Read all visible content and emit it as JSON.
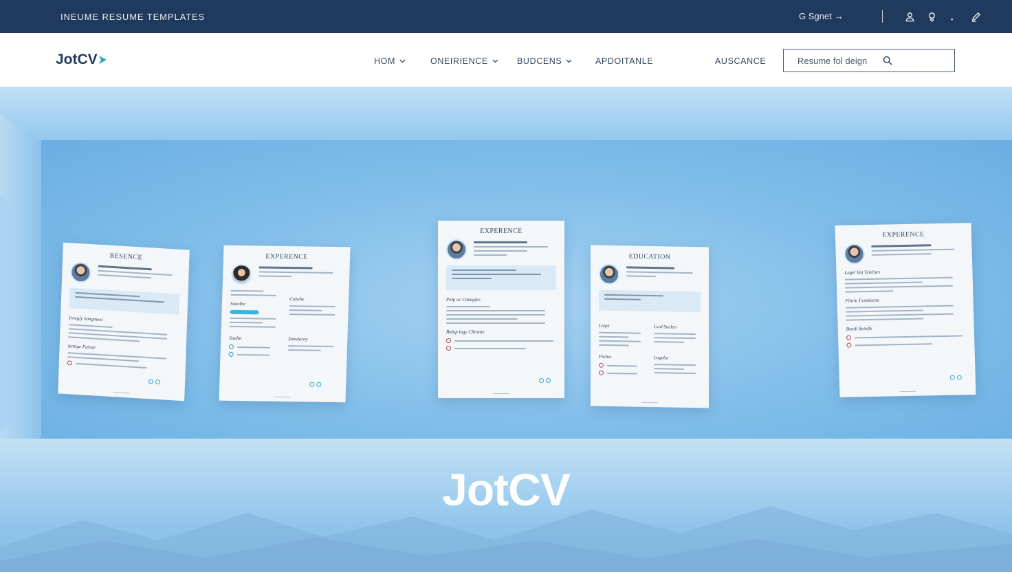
{
  "topbar": {
    "title": "INEUME RESUME TEMPLATES",
    "signin_label": "G Sgnet",
    "signin_arrow": "→",
    "icons": [
      "user-icon",
      "lightbulb-icon",
      "edit-icon"
    ]
  },
  "nav": {
    "logo": "JotCV",
    "items": [
      {
        "label": "HOM",
        "has_dropdown": true
      },
      {
        "label": "ONEIRIENCE",
        "has_dropdown": true
      },
      {
        "label": "BUDCENS",
        "has_dropdown": true
      },
      {
        "label": "APDOITANLE",
        "has_dropdown": false
      },
      {
        "label": "AUSCANCE",
        "has_dropdown": false
      }
    ],
    "search": {
      "value": "Resume fol deign",
      "icon": "search-icon"
    }
  },
  "hero": {
    "brand": "JotCV",
    "cards": [
      {
        "title": "RESENCE",
        "sections": [
          "Irnegly Iemgmeet",
          "Ientige Fettsie"
        ]
      },
      {
        "title": "EXPERENCE",
        "sections": [
          "Sonelbe",
          "Cohebe",
          "Sotdnt",
          "Somdorny"
        ]
      },
      {
        "title": "EXPERENCE",
        "sections": [
          "Pnlp ac Cnnegiee",
          "Bnlup tngy Cllnsnte"
        ]
      },
      {
        "title": "EDUCATION",
        "sections": [
          "Liepe",
          "Lsrd Suelen",
          "Ftalue",
          "Lugeba"
        ]
      },
      {
        "title": "EXPERENCE",
        "sections": [
          "Lagel llat Tetelnes",
          "Flnrlu Fesstleenn",
          "Bendl Retnfls"
        ]
      }
    ]
  },
  "colors": {
    "topbar_bg": "#1f3a5c",
    "accent": "#3ab3dd",
    "hero_sky": "#86c1ec"
  }
}
